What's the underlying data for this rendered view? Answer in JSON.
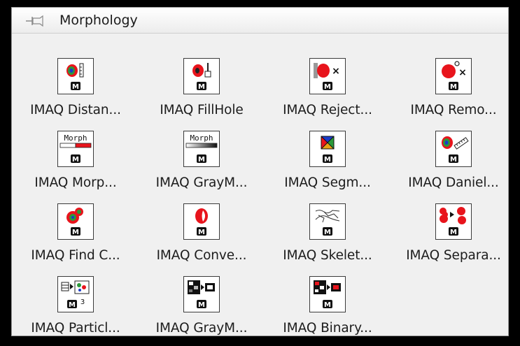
{
  "palette": {
    "title": "Morphology",
    "pin_icon": "pin-icon"
  },
  "items": [
    {
      "label": "IMAQ Distan...",
      "icon": "distance-icon"
    },
    {
      "label": "IMAQ FillHole",
      "icon": "fill-hole-icon"
    },
    {
      "label": "IMAQ Reject...",
      "icon": "reject-border-icon"
    },
    {
      "label": "IMAQ Remo...",
      "icon": "remove-particle-icon"
    },
    {
      "label": "IMAQ Morp...",
      "icon": "morphology-icon",
      "icon_text": "Morph"
    },
    {
      "label": "IMAQ GrayM...",
      "icon": "gray-morphology-icon",
      "icon_text": "Morph"
    },
    {
      "label": "IMAQ Segm...",
      "icon": "segmentation-icon"
    },
    {
      "label": "IMAQ Daniel...",
      "icon": "danielsson-icon"
    },
    {
      "label": "IMAQ Find C...",
      "icon": "find-circles-icon"
    },
    {
      "label": "IMAQ Conve...",
      "icon": "convex-hull-icon"
    },
    {
      "label": "IMAQ Skelet...",
      "icon": "skeleton-icon"
    },
    {
      "label": "IMAQ Separa...",
      "icon": "separation-icon"
    },
    {
      "label": "IMAQ Particl...",
      "icon": "particle-filter-icon",
      "icon_badge": "3"
    },
    {
      "label": "IMAQ GrayM...",
      "icon": "gray-morphology-2-icon"
    },
    {
      "label": "IMAQ Binary...",
      "icon": "binary-morphology-icon"
    }
  ],
  "colors": {
    "blob_red": "#e8141c",
    "blob_green": "#2a9a3a",
    "blob_blue": "#1b3cc8"
  }
}
